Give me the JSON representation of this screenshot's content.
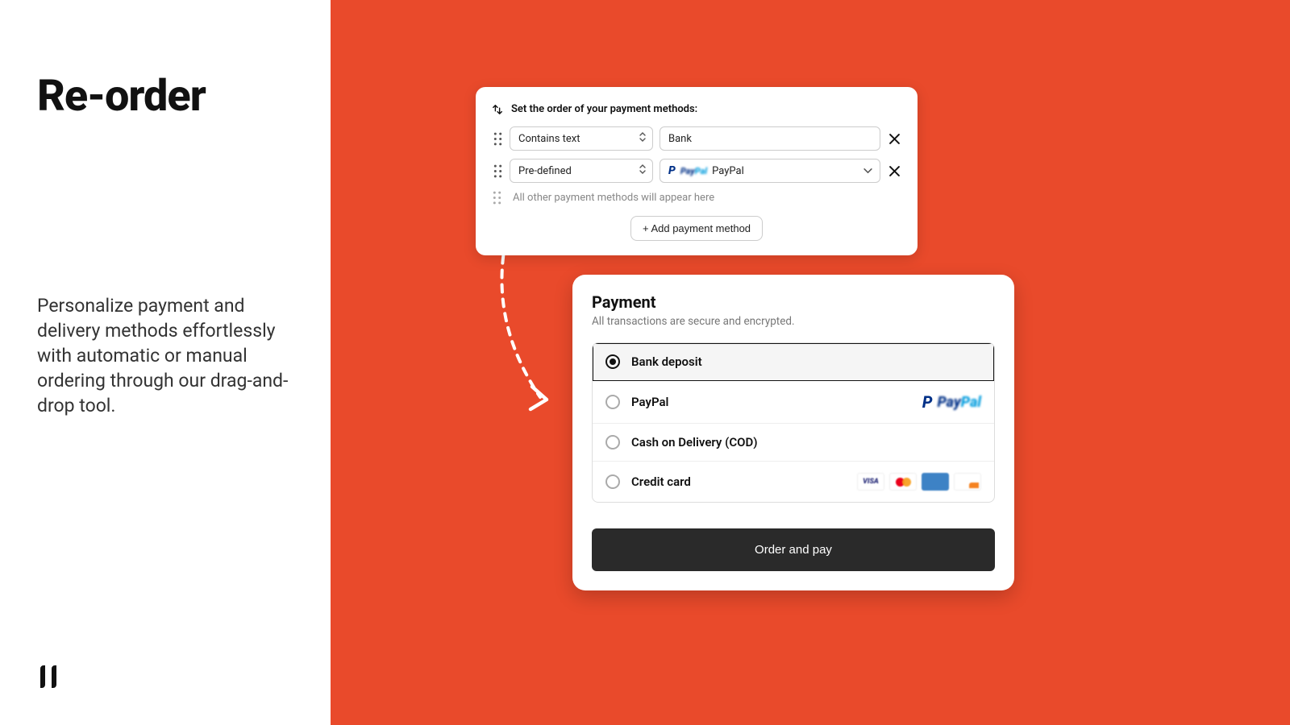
{
  "colors": {
    "accent": "#e94a2b",
    "cta_bg": "#2a2a2a"
  },
  "page": {
    "title": "Re-order",
    "description": "Personalize payment and delivery methods effortlessly with automatic or manual ordering through our drag-and-drop tool."
  },
  "config": {
    "header": "Set the order of your payment methods:",
    "rows": [
      {
        "selector": "Contains text",
        "value": "Bank",
        "value_type": "text"
      },
      {
        "selector": "Pre-defined",
        "value": "PayPal",
        "value_type": "dropdown",
        "icon": "paypal"
      }
    ],
    "placeholder": "All other payment methods will appear here",
    "add_button": "+ Add payment method"
  },
  "checkout": {
    "title": "Payment",
    "subtitle": "All transactions are secure and encrypted.",
    "options": [
      {
        "label": "Bank deposit",
        "selected": true,
        "brands": []
      },
      {
        "label": "PayPal",
        "selected": false,
        "brands": [
          "paypal"
        ]
      },
      {
        "label": "Cash on Delivery (COD)",
        "selected": false,
        "brands": []
      },
      {
        "label": "Credit card",
        "selected": false,
        "brands": [
          "visa",
          "mastercard",
          "amex",
          "discover"
        ]
      }
    ],
    "cta": "Order and pay"
  }
}
